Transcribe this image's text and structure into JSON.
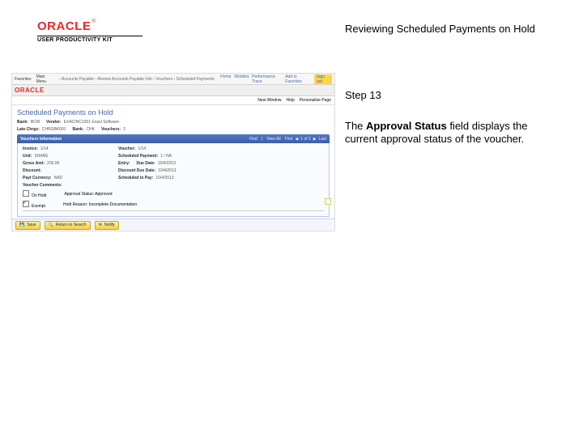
{
  "logo": {
    "brand": "ORACLE",
    "tm": "®",
    "subtitle": "USER PRODUCTIVITY KIT"
  },
  "right": {
    "title": "Reviewing Scheduled Payments on Hold",
    "step": "Step 13",
    "desc_prefix": "The ",
    "desc_bold": "Approval Status",
    "desc_suffix": " field displays the current approval status of the voucher."
  },
  "shot": {
    "topbar": {
      "favorites": "Favorites",
      "mainmenu": "Main Menu",
      "breadcrumb": "› Accounts Payable › Review Accounts Payable Info › Vouchers › Scheduled Payments on Hold",
      "home": "Home",
      "worklist": "Worklist",
      "perf_trace": "Performance Trace",
      "addfav": "Add to Favorites",
      "signout": "Sign out"
    },
    "brandbar": {
      "brand": "ORACLE",
      "new_window": "New Window",
      "help": "Help",
      "personalize": "Personalize Page"
    },
    "title": "Scheduled Payments on Hold",
    "meta": {
      "bank_lbl": "Bank:",
      "bank_val": "BCM",
      "vendor_lbl": "Vendor:",
      "vendor_val": "EXACINC1001   Exact Software",
      "late_lbl": "Late Chrgs:",
      "late_val": "CHRGBK001",
      "bankacct_lbl": "Bank:",
      "bankacct_val": "CHK",
      "vouchers_lbl": "Vouchers:",
      "vouchers_val": "2"
    },
    "grid": {
      "header": "Vouchers Information",
      "find": "Find",
      "view_all": "View All",
      "pager_first": "First",
      "pager_count": "1 of 2",
      "pager_last": "Last"
    },
    "grow": {
      "invoice_lbl": "Invoice:",
      "invoice_val": "1/14",
      "voucher_lbl": "Voucher:",
      "voucher_val": "1/14",
      "unit_lbl": "Unit:",
      "unit_val": "SHARE",
      "schedpay_lbl": "Scheduled Payment:",
      "schedpay_val": "1 / NA",
      "gross_lbl": "Gross Amt:",
      "gross_val": "200.00",
      "entry_lbl": "Entry:",
      "entry_val": "",
      "due_lbl": "Due Date:",
      "due_val": "10/4/2013",
      "disc_lbl": "Discount:",
      "disc_val": "",
      "discdue_lbl": "Discount Due Date:",
      "discdue_val": "10/4/2013",
      "paycur_lbl": "Payt Currency:",
      "paycur_val": "NAD",
      "schedue_lbl": "Scheduled to Pay:",
      "schedue_val": "10/4/2013"
    },
    "comments_lbl": "Voucher Comments:",
    "hold": {
      "onhold_chk_label": "On Hold",
      "exempt_chk_label": "Exempt",
      "approval_lbl": "Approval Status:",
      "approval_val": "Approved",
      "holdreason_lbl": "Hold Reason:",
      "holdreason_val": "Incomplete Documentation"
    },
    "save": {
      "save": "Save",
      "return": "Return to Search",
      "notify": "Notify"
    }
  }
}
